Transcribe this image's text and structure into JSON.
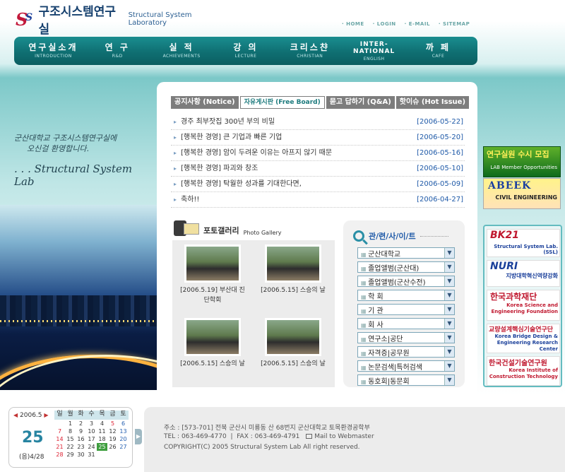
{
  "header": {
    "logo_mark": "S",
    "logo_mark2": "S",
    "title_ko": "구조시스템연구실",
    "title_en": "Structural System Laboratory",
    "top_links": [
      "HOME",
      "LOGIN",
      "E-MAIL",
      "SITEMAP"
    ]
  },
  "nav": [
    {
      "ko": "연구실소개",
      "en": "INTRODUCTION"
    },
    {
      "ko": "연 구",
      "en": "R&D"
    },
    {
      "ko": "실 적",
      "en": "ACHIEVEMENTS"
    },
    {
      "ko": "강 의",
      "en": "LECTURE"
    },
    {
      "ko": "크리스챤",
      "en": "CHRISTIAN"
    },
    {
      "ko": "INTER-NATIONAL",
      "en": "ENGLISH"
    },
    {
      "ko": "까 페",
      "en": "CAFE"
    }
  ],
  "welcome": {
    "line1": "군산대학교 구조시스템연구실에",
    "line2": "오신걸 환영합니다.",
    "line3": ". . . Structural System Lab"
  },
  "tabs": [
    "공지사항 (Notice)",
    "자유게시판 (Free Board)",
    "묻고 답하기 (Q&A)",
    "핫이슈 (Hot Issue)"
  ],
  "board": [
    {
      "title": "경주 최부잣집 300년 부의 비밀",
      "date": "[2006-05-22]"
    },
    {
      "title": "[행복한 경영] 큰 기업과 빠른 기업",
      "date": "[2006-05-20]"
    },
    {
      "title": "[행복한 경영] 암이 두려운 이유는 아프지 않기 때문",
      "date": "[2006-05-16]"
    },
    {
      "title": "[행복한 경영] 파괴와 창조",
      "date": "[2006-05-10]"
    },
    {
      "title": "[행복한 경영] 탁월한 성과를 기대한다면,",
      "date": "[2006-05-09]"
    },
    {
      "title": "축하!!",
      "date": "[2006-04-27]"
    }
  ],
  "gallery": {
    "title_ko": "포토갤러리",
    "title_en": "Photo Gallery",
    "items": [
      {
        "cap1": "[2006.5.19] 부산대 진",
        "cap2": "단학회"
      },
      {
        "cap1": "[2006.5.15] 스승의 날",
        "cap2": ""
      },
      {
        "cap1": "[2006.5.15] 스승의 날",
        "cap2": ""
      },
      {
        "cap1": "[2006.5.15] 스승의 날",
        "cap2": ""
      }
    ]
  },
  "links": {
    "title": "관/련/사/이/트",
    "selects": [
      "군산대학교",
      "졸업앨범(군산대)",
      "졸업앨범(군산수전)",
      "학 회",
      "기 관",
      "회 사",
      "연구소|공단",
      "자격증|공무원",
      "논문검색|특허검색",
      "동호회|동문회"
    ]
  },
  "banners": {
    "b1a": "연구실원 수시 모집",
    "b1b": "LAB Member Opportunities",
    "b2a": "ABEEK",
    "b2b": "CIVIL ENGINEERING",
    "g1a": "BK21",
    "g1b": "Structural System Lab. (SSL)",
    "g2a": "NURI",
    "g2b": "지방대학혁신역량강화",
    "g3a": "한국과학재단",
    "g3b": "Korea Science and Engineering Foundation",
    "g4a": "교량설계핵심기술연구단",
    "g4b": "Korea Bridge Design & Engineering Research Center",
    "g5a": "한국건설기술연구원",
    "g5b": "Korea Institute of Construction Technology"
  },
  "calendar": {
    "prev": "◀",
    "next": "▶",
    "month": "2006.5",
    "day": "25",
    "lunar": "(음)4/28",
    "toggle": "▶",
    "headers": [
      "일",
      "월",
      "화",
      "수",
      "목",
      "금",
      "토"
    ],
    "weeks": [
      [
        "",
        "1",
        "2",
        "3",
        "4",
        "5",
        "6"
      ],
      [
        "7",
        "8",
        "9",
        "10",
        "11",
        "12",
        "13"
      ],
      [
        "14",
        "15",
        "16",
        "17",
        "18",
        "19",
        "20"
      ],
      [
        "21",
        "22",
        "23",
        "24",
        "25",
        "26",
        "27"
      ],
      [
        "28",
        "29",
        "30",
        "31",
        "",
        "",
        ""
      ]
    ]
  },
  "footer": {
    "address": "주소 : [573-701] 전북 군산시 미룡동 산 68번지 군산대학교 토목환경공학부",
    "tel": "TEL : 063-469-4770",
    "fax": "FAX : 063-469-4791",
    "mail": "Mail to Webmaster",
    "copyright": "COPYRIGHT(C) 2005 Structural System Lab All right reserved."
  },
  "colors": {
    "accent": "#0f6f72",
    "date": "#1f5aa8",
    "tab": "#7d7d7d",
    "today": "#3e9e3e"
  }
}
